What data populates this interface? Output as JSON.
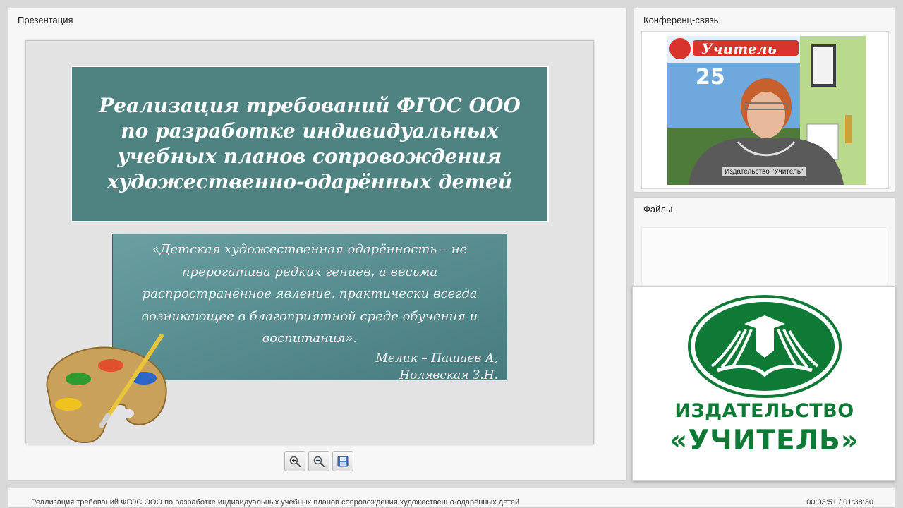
{
  "presentation": {
    "panel_title": "Презентация",
    "slide": {
      "title": "Реализация требований ФГОС ООО по разработке индивидуальных учебных планов сопровождения художественно-одарённых детей",
      "quote": "«Детская художественная одарённость – не прерогатива редких гениев,  а весьма распространённое явление, практически всегда возникающее в благоприятной среде обучения и воспитания».",
      "author_line1": "Мелик – Пашаев А,",
      "author_line2": "Нолявская З.Н."
    },
    "toolbar": [
      {
        "name": "zoom-in",
        "icon": "zoom-in-icon"
      },
      {
        "name": "zoom-out",
        "icon": "zoom-out-icon"
      },
      {
        "name": "save",
        "icon": "save-icon"
      }
    ]
  },
  "conference": {
    "panel_title": "Конференц-связь",
    "video_label": "Издательство \"Учитель\""
  },
  "files": {
    "panel_title": "Файлы"
  },
  "logo": {
    "line1": "ИЗДАТЕЛЬСТВО",
    "line2": "«УЧИТЕЛЬ»",
    "color": "#0e7a36"
  },
  "footer": {
    "title": "Реализация требований ФГОС ООО по разработке индивидуальных учебных планов сопровождения художественно-одарённых детей",
    "time": "00:03:51 / 01:38:30"
  }
}
